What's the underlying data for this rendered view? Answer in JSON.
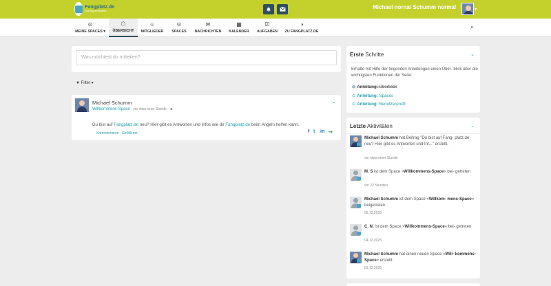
{
  "header": {
    "logo_title": "Fangplatz.de",
    "logo_sub": "Das Anglernetzwerk",
    "notifications_icon": "bell-icon",
    "messages_icon": "envelope-icon",
    "user_name": "Michael nornal Schumm normal",
    "brand_color": "#c4d12c"
  },
  "nav": {
    "items": [
      {
        "icon": "⊙",
        "label": "MEINE SPACES ▾"
      },
      {
        "icon": "☖",
        "label": "ÜBERSICHT"
      },
      {
        "icon": "☺",
        "label": "MITGLIEDER"
      },
      {
        "icon": "⊙",
        "label": "SPACES"
      },
      {
        "icon": "✉",
        "label": "NACHRICHTEN"
      },
      {
        "icon": "▦",
        "label": "KALENDER"
      },
      {
        "icon": "☑",
        "label": "AUFGABEN"
      },
      {
        "icon": "◑",
        "label": "ZU FANGPLATZ.DE"
      }
    ],
    "search_icon": "⌕"
  },
  "composer": {
    "placeholder": "Was möchtest du mitteilen?"
  },
  "filter": {
    "label": "Filter"
  },
  "post": {
    "author": "Michael Schumm",
    "space": "Willkommens-Space",
    "time": "· vor etwa einer Stunde ·",
    "text_1": "Du bist auf ",
    "link_1": "Fangplatz.de",
    "text_2": " neu? Hier gibt es Antworten und Infos wie dir ",
    "link_2": "Fangplatz.de",
    "text_3": " beim Angeln helfen kann.",
    "comment_label": "Kommentieren",
    "like_label": "Gefällt mir",
    "link_color": "#21a1b3"
  },
  "steps": {
    "title_bold": "Erste",
    "title_rest": " Schritte",
    "description": "Erhalte mit Hilfe der folgenden Anleitungen einen Über- blick über die wichtigsten Funktionen der Seite:",
    "items": [
      {
        "bold": "Anleitung:",
        "rest": " Überblick"
      },
      {
        "bold": "Anleitung:",
        "rest": " Spaces"
      },
      {
        "bold": "Anleitung:",
        "rest": " Benutzerprofil"
      }
    ]
  },
  "activity": {
    "title_bold": "Letzte",
    "title_rest": " Aktivitäten",
    "items": [
      {
        "actor": "Michael Schumm",
        "text": " hat Beitrag \"Du bist auf Fang- platz.de neu? Hier gibt es Antworten und Inf...\" erstellt.",
        "time": "vor etwa einer Stunde"
      },
      {
        "actor": "M. S",
        "text_a": " ist dem Space »",
        "space": "Willkommens-Space",
        "text_b": "« bei- getreten",
        "time": "vor 22 Stunden"
      },
      {
        "actor": "Michael Schumm",
        "text_a": " ist dem Space »",
        "space": "Willkom- mens-Space",
        "text_b": "« beigetreten",
        "time": "05.12.2025"
      },
      {
        "actor": "C. N.",
        "text_a": " ist dem Space »",
        "space": "Willkommens-Space",
        "text_b": "« bei- getreten",
        "time": "04.12.2025"
      },
      {
        "actor": "Michael Schumm",
        "text_a": " hat einen neuen Space »",
        "space": "Will- kommens-Space",
        "text_b": "« erstellt.",
        "time": "03.12.2025"
      }
    ]
  }
}
